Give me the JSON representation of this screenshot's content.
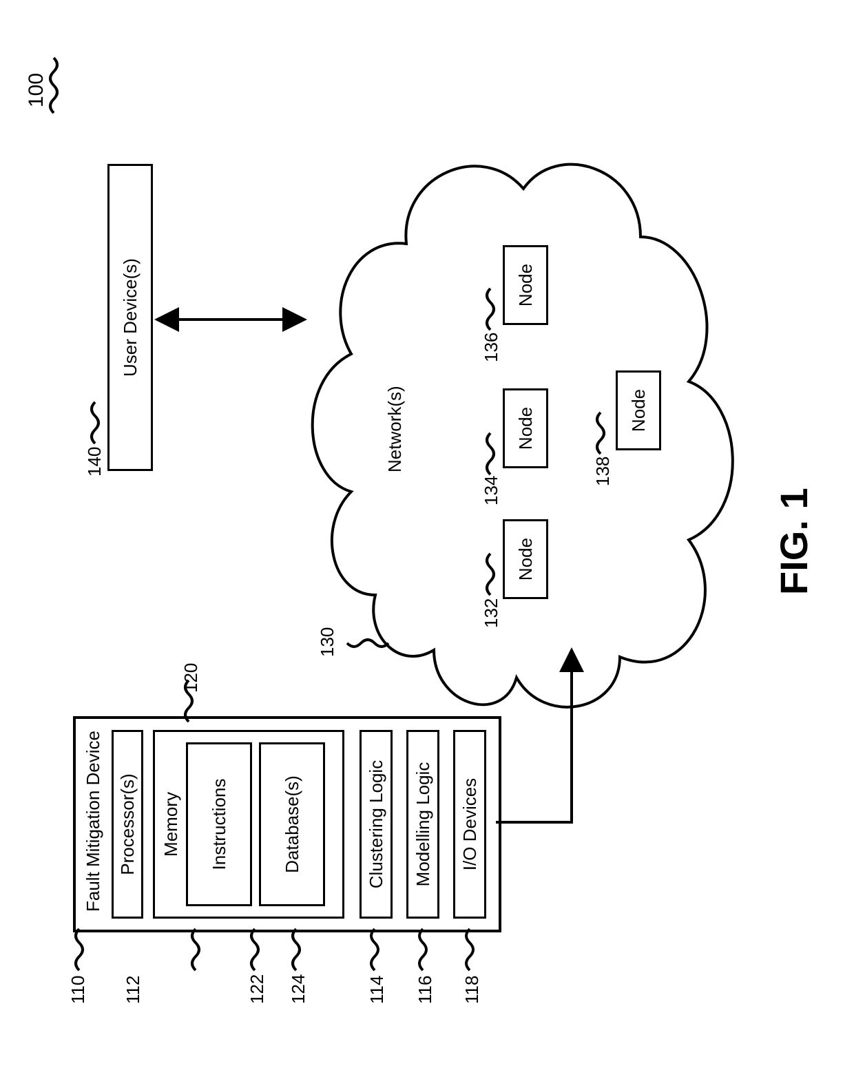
{
  "figure_label": "FIG. 1",
  "refs": {
    "r100": "100",
    "r110": "110",
    "r112": "112",
    "r114": "114",
    "r116": "116",
    "r118": "118",
    "r120": "120",
    "r122": "122",
    "r124": "124",
    "r130": "130",
    "r132": "132",
    "r134": "134",
    "r136": "136",
    "r138": "138",
    "r140": "140"
  },
  "blocks": {
    "fault_mitigation": "Fault Mitigation Device",
    "processors": "Processor(s)",
    "memory": "Memory",
    "instructions": "Instructions",
    "databases": "Database(s)",
    "clustering": "Clustering Logic",
    "modelling": "Modelling Logic",
    "io": "I/O Devices",
    "networks": "Network(s)",
    "node": "Node",
    "user_devices": "User Device(s)"
  }
}
